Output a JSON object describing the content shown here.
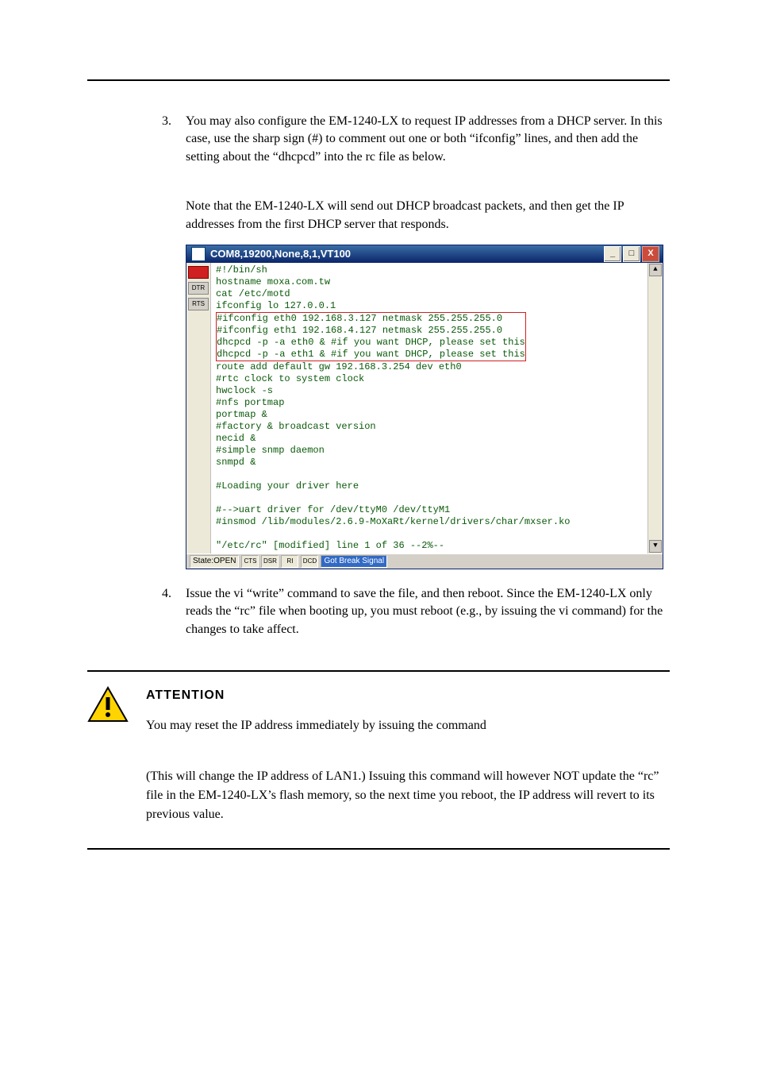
{
  "step3": {
    "num": "3.",
    "text": "You may also configure the EM-1240-LX to request IP addresses from a DHCP server. In this case, use the sharp sign (#) to comment out one or both “ifconfig” lines, and then add the setting about the “dhcpcd” into the rc file as below."
  },
  "note3": "Note that the EM-1240-LX will send out DHCP broadcast packets, and then get the IP addresses from the first DHCP server that responds.",
  "terminal": {
    "title": "COM8,19200,None,8,1,VT100",
    "win_min": "_",
    "win_max": "□",
    "win_close": "X",
    "gutter": {
      "dtr": "DTR",
      "rts": "RTS"
    },
    "lines": {
      "l1": "#!/bin/sh",
      "l2": "hostname moxa.com.tw",
      "l3": "cat /etc/motd",
      "l4": "ifconfig lo 127.0.0.1",
      "l5": "#ifconfig eth0 192.168.3.127 netmask 255.255.255.0",
      "l6": "#ifconfig eth1 192.168.4.127 netmask 255.255.255.0",
      "l7": "dhcpcd -p -a eth0 &     #if you want DHCP, please set this",
      "l8": "dhcpcd -p -a eth1 &     #if you want DHCP, please set this",
      "l9": "route add default gw 192.168.3.254 dev eth0",
      "l10": "#rtc clock to system clock",
      "l11": "hwclock -s",
      "l12": "#nfs portmap",
      "l13": "portmap &",
      "l14": "#factory & broadcast version",
      "l15": "necid &",
      "l16": "#simple snmp daemon",
      "l17": "snmpd &",
      "l18": "",
      "l19": "#Loading your driver here",
      "l20": "",
      "l21": "#-->uart driver for /dev/ttyM0 /dev/ttyM1",
      "l22": "#insmod /lib/modules/2.6.9-MoXaRt/kernel/drivers/char/mxser.ko",
      "l23": "",
      "l24": "\"/etc/rc\" [modified] line 1 of 36 --2%--"
    },
    "status": {
      "state": "State:OPEN",
      "cts": "CTS",
      "dsr": "DSR",
      "ri": "RI",
      "dcd": "DCD",
      "msg": "Got Break Signal"
    },
    "scroll_up": "▲",
    "scroll_down": "▼"
  },
  "step4": {
    "num": "4.",
    "text": "Issue the vi “write” command to save the file, and then reboot. Since the EM-1240-LX only reads the “rc” file when booting up, you must reboot (e.g., by issuing the vi command) for the changes to take affect."
  },
  "attention": {
    "heading": "ATTENTION",
    "p1": "You may reset the IP address immediately by issuing the command",
    "p2": "(This will change the IP address of LAN1.) Issuing this command will however NOT update the “rc” file in the EM-1240-LX’s flash memory, so the next time you reboot, the IP address will revert to its previous value."
  }
}
